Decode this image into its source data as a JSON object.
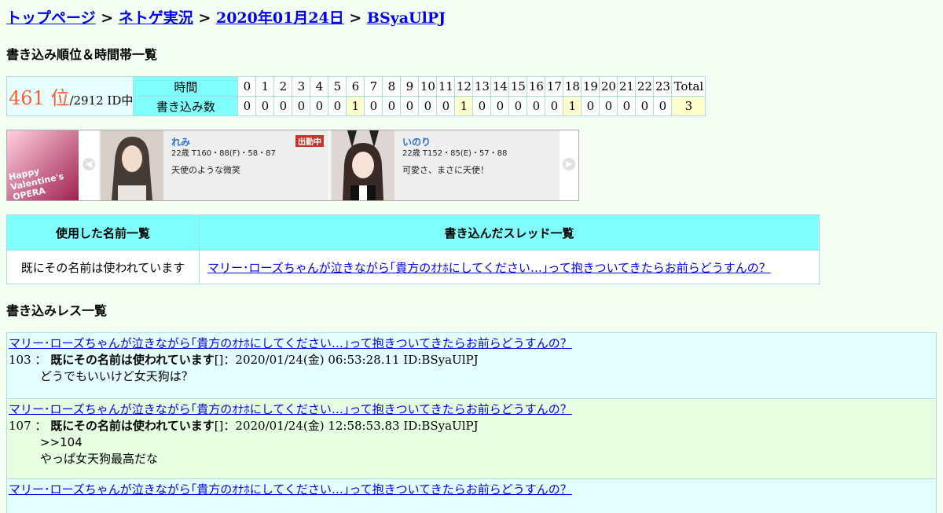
{
  "breadcrumb": {
    "items": [
      "トップページ",
      "ネトゲ実況",
      "2020年01月24日",
      "BSyaUlPJ"
    ],
    "separator": ">"
  },
  "rank_section": {
    "heading": "書き込み順位＆時間帯一覧",
    "rank": "461 位",
    "of_total": "/2912 ID中",
    "hours_label": "時間",
    "count_label": "書き込み数",
    "hours": [
      "0",
      "1",
      "2",
      "3",
      "4",
      "5",
      "6",
      "7",
      "8",
      "9",
      "10",
      "11",
      "12",
      "13",
      "14",
      "15",
      "16",
      "17",
      "18",
      "19",
      "20",
      "21",
      "22",
      "23"
    ],
    "counts": [
      "0",
      "0",
      "0",
      "0",
      "0",
      "0",
      "1",
      "0",
      "0",
      "0",
      "0",
      "0",
      "1",
      "0",
      "0",
      "0",
      "0",
      "0",
      "1",
      "0",
      "0",
      "0",
      "0",
      "0"
    ],
    "total_label": "Total",
    "total_value": "3"
  },
  "banner": {
    "ad_text": "Happy Valentine's OPERA",
    "cards": [
      {
        "name": "れみ",
        "stats": "22歳 T160・88(F)・58・87",
        "desc": "天使のような微笑",
        "badge": "出勤中"
      },
      {
        "name": "いのり",
        "stats": "22歳 T152・85(E)・57・88",
        "desc": "可愛さ、まさに天使！",
        "badge": ""
      }
    ]
  },
  "lists": {
    "names_header": "使用した名前一覧",
    "threads_header": "書き込んだスレッド一覧",
    "name": "既にその名前は使われています",
    "thread": "マリー･ローズちゃんが泣きながら｢貴方のｵﾅﾎにしてください…｣って抱きついてきたらお前らどうすんの？"
  },
  "posts_section": {
    "heading": "書き込みレス一覧",
    "posts": [
      {
        "thread": "マリー･ローズちゃんが泣きながら｢貴方のｵﾅﾎにしてください…｣って抱きついてきたらお前らどうすんの？",
        "num": "103 ：",
        "name": "既にその名前は使われています",
        "suffix": "[]：2020/01/24(金) 06:53:28.11 ID:BSyaUlPJ",
        "line1": "どうでもいいけど女天狗は？",
        "line2": ""
      },
      {
        "thread": "マリー･ローズちゃんが泣きながら｢貴方のｵﾅﾎにしてください…｣って抱きついてきたらお前らどうすんの？",
        "num": "107 ：",
        "name": "既にその名前は使われています",
        "suffix": "[]：2020/01/24(金) 12:58:53.83 ID:BSyaUlPJ",
        "line1": ">>104",
        "line2": "やっぱ女天狗最高だな"
      },
      {
        "thread": "マリー･ローズちゃんが泣きながら｢貴方のｵﾅﾎにしてください…｣って抱きついてきたらお前らどうすんの？",
        "num": "",
        "name": "",
        "suffix": "",
        "line1": "",
        "line2": ""
      }
    ]
  }
}
